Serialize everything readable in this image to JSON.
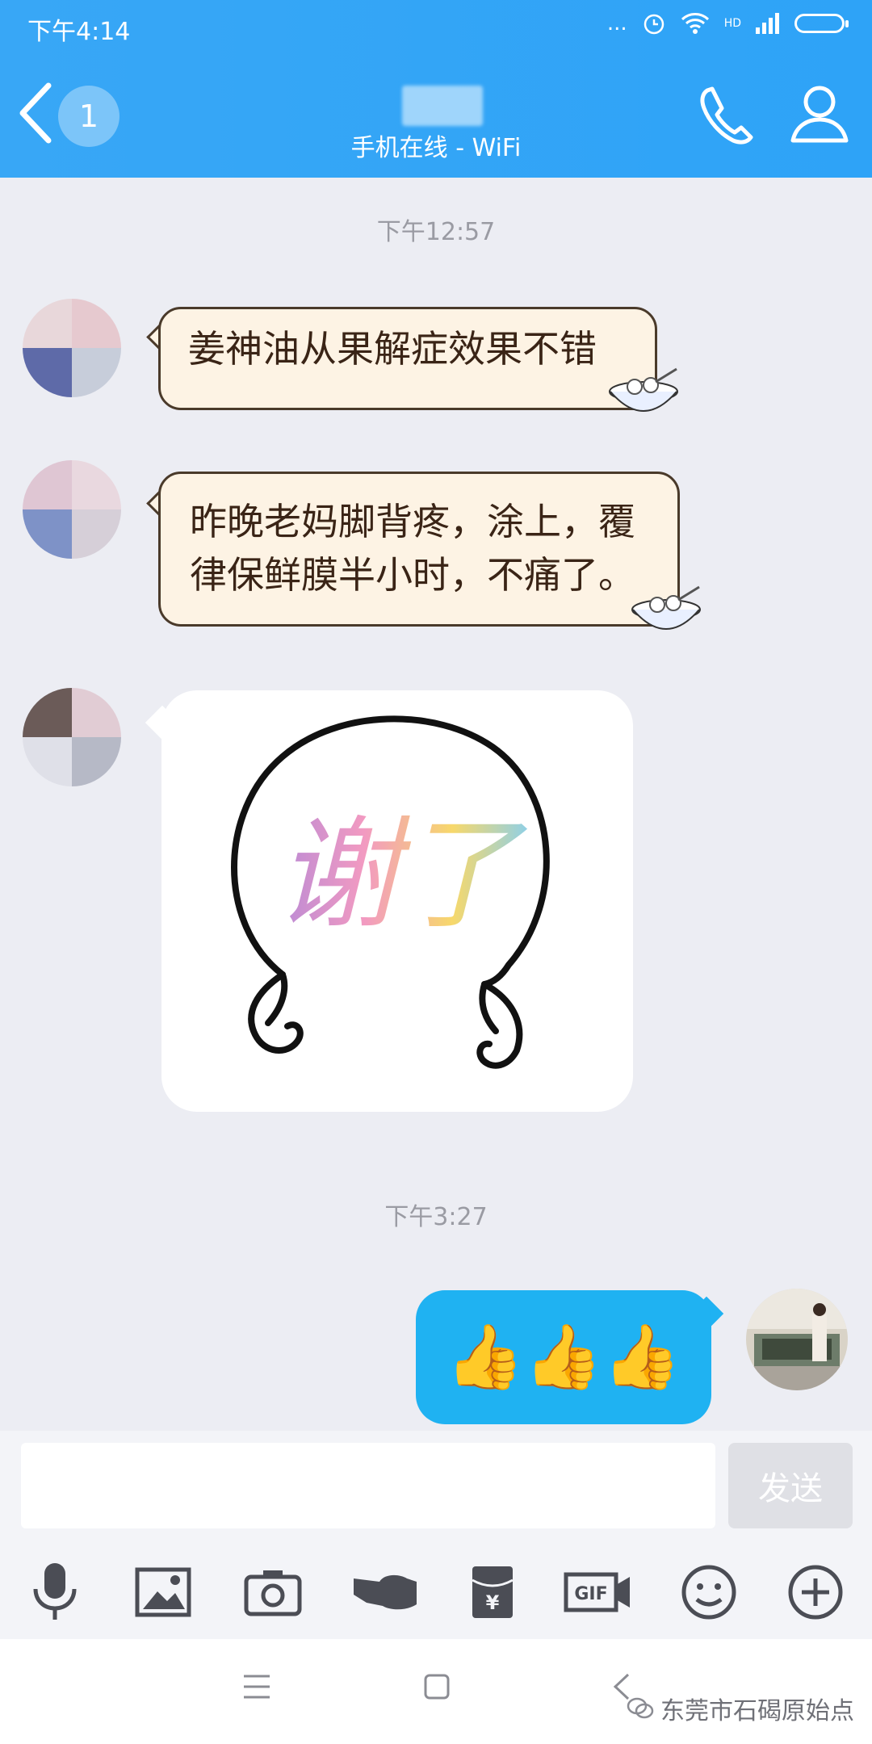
{
  "status_bar": {
    "time": "下午4:14",
    "dots": "...",
    "hd_label": "HD"
  },
  "header": {
    "unread_count": "1",
    "contact_status": "手机在线 - WiFi"
  },
  "timestamps": [
    "下午12:57",
    "下午3:27"
  ],
  "messages": [
    {
      "direction": "incoming",
      "text": "姜神油从果解症效果不错"
    },
    {
      "direction": "incoming",
      "text_line1": "昨晚老妈脚背疼，涂上，覆",
      "text_line2": "律保鲜膜半小时，不痛了。"
    },
    {
      "direction": "incoming",
      "type": "sticker",
      "sticker_text": "谢了"
    },
    {
      "direction": "outgoing",
      "type": "emoji",
      "text": "👍👍👍"
    }
  ],
  "input": {
    "placeholder": "",
    "send_label": "发送",
    "gif_label": "GIF",
    "yen_label": "¥"
  },
  "watermark": {
    "text": "东莞市石碣原始点"
  },
  "colors": {
    "header": "#2ea3f7",
    "outgoing_bubble": "#1fb2f2",
    "incoming_bubble": "#fdf3e4"
  }
}
